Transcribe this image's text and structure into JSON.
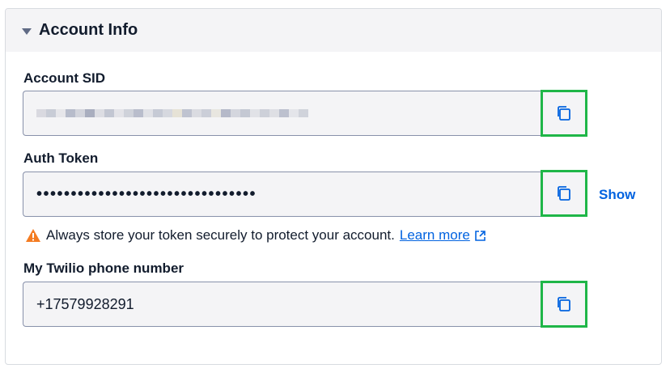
{
  "card": {
    "title": "Account Info",
    "caret_icon": "caret-down-icon"
  },
  "account_sid": {
    "label": "Account SID",
    "value_redacted": true,
    "copy_icon": "copy-icon"
  },
  "auth_token": {
    "label": "Auth Token",
    "masked_value": "••••••••••••••••••••••••••••••••",
    "show_label": "Show",
    "copy_icon": "copy-icon"
  },
  "helper": {
    "warning_icon": "warning-icon",
    "text": "Always store your token securely to protect your account.",
    "link_text": "Learn more",
    "link_icon": "external-link-icon"
  },
  "phone": {
    "label": "My Twilio phone number",
    "value": "+17579928291",
    "copy_icon": "copy-icon"
  },
  "colors": {
    "highlight_border": "#1fb648",
    "link": "#0263e0",
    "warning": "#f47c22",
    "field_bg": "#f4f4f6"
  }
}
